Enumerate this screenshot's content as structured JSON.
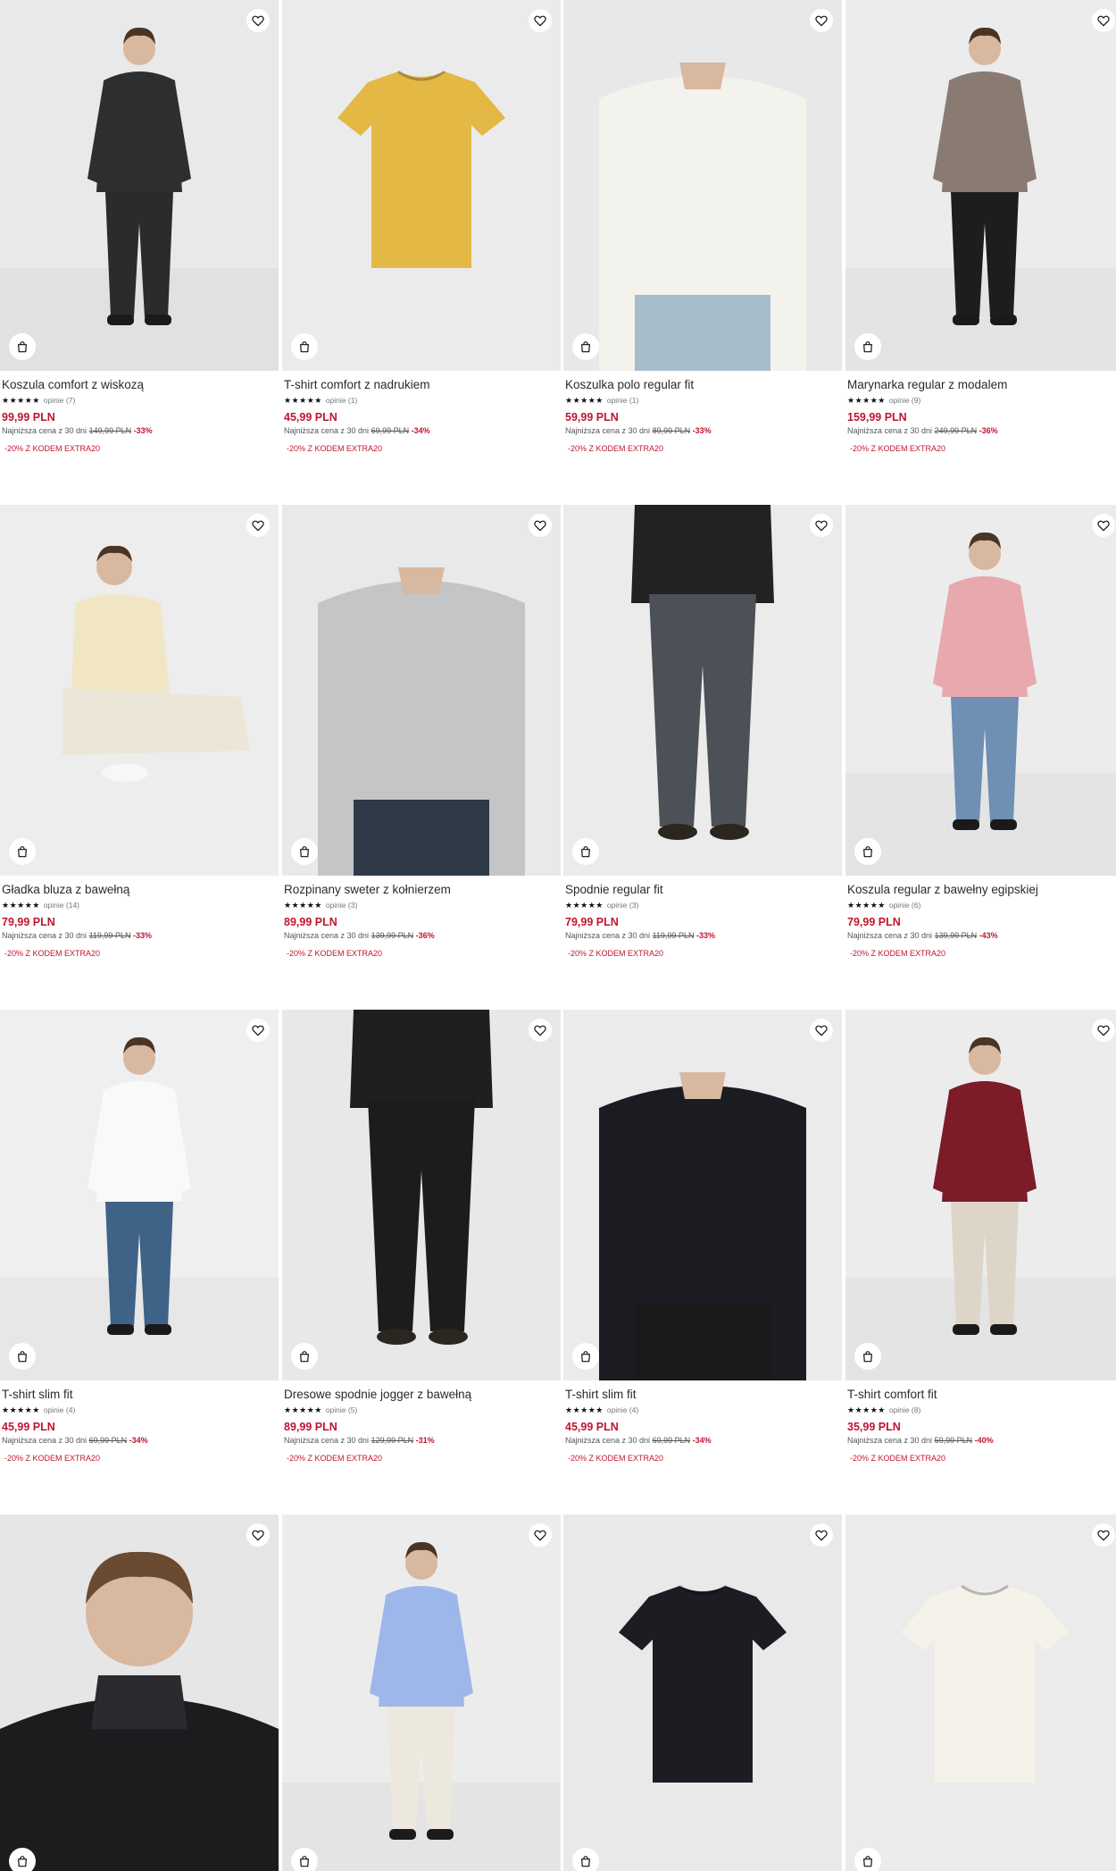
{
  "colors": {
    "price": "#c0152f",
    "promo": "#c0152f",
    "photo_bg": "#eeeeee"
  },
  "icons": {
    "favorite": "heart-icon",
    "add_to_bag": "shopping-bag-icon",
    "rating": "star-icon"
  },
  "products": [
    {
      "name": "Koszula comfort z wiskozą",
      "stars": "★★★★★",
      "reviews": "opinie (7)",
      "price": "99,99 PLN",
      "lowest_label": "Najniższa cena z 30 dni",
      "old_price": "149,99 PLN",
      "discount": "-33%",
      "promo": "-20% Z KODEM EXTRA20"
    },
    {
      "name": "T-shirt comfort z nadrukiem",
      "stars": "★★★★★",
      "reviews": "opinie (1)",
      "price": "45,99 PLN",
      "lowest_label": "Najniższa cena z 30 dni",
      "old_price": "69,99 PLN",
      "discount": "-34%",
      "promo": "-20% Z KODEM EXTRA20"
    },
    {
      "name": "Koszulka polo regular fit",
      "stars": "★★★★★",
      "reviews": "opinie (1)",
      "price": "59,99 PLN",
      "lowest_label": "Najniższa cena z 30 dni",
      "old_price": "89,99 PLN",
      "discount": "-33%",
      "promo": "-20% Z KODEM EXTRA20"
    },
    {
      "name": "Marynarka regular z modalem",
      "stars": "★★★★★",
      "reviews": "opinie (9)",
      "price": "159,99 PLN",
      "lowest_label": "Najniższa cena z 30 dni",
      "old_price": "249,99 PLN",
      "discount": "-36%",
      "promo": "-20% Z KODEM EXTRA20"
    },
    {
      "name": "Gładka bluza z bawełną",
      "stars": "★★★★★",
      "reviews": "opinie (14)",
      "price": "79,99 PLN",
      "lowest_label": "Najniższa cena z 30 dni",
      "old_price": "119,99 PLN",
      "discount": "-33%",
      "promo": "-20% Z KODEM EXTRA20"
    },
    {
      "name": "Rozpinany sweter z kołnierzem",
      "stars": "★★★★★",
      "reviews": "opinie (3)",
      "price": "89,99 PLN",
      "lowest_label": "Najniższa cena z 30 dni",
      "old_price": "139,99 PLN",
      "discount": "-36%",
      "promo": "-20% Z KODEM EXTRA20"
    },
    {
      "name": "Spodnie regular fit",
      "stars": "★★★★★",
      "reviews": "opinie (3)",
      "price": "79,99 PLN",
      "lowest_label": "Najniższa cena z 30 dni",
      "old_price": "119,99 PLN",
      "discount": "-33%",
      "promo": "-20% Z KODEM EXTRA20"
    },
    {
      "name": "Koszula regular z bawełny egipskiej",
      "stars": "★★★★★",
      "reviews": "opinie (6)",
      "price": "79,99 PLN",
      "lowest_label": "Najniższa cena z 30 dni",
      "old_price": "139,99 PLN",
      "discount": "-43%",
      "promo": "-20% Z KODEM EXTRA20"
    },
    {
      "name": "T-shirt slim fit",
      "stars": "★★★★★",
      "reviews": "opinie (4)",
      "price": "45,99 PLN",
      "lowest_label": "Najniższa cena z 30 dni",
      "old_price": "69,99 PLN",
      "discount": "-34%",
      "promo": "-20% Z KODEM EXTRA20"
    },
    {
      "name": "Dresowe spodnie jogger z bawełną",
      "stars": "★★★★★",
      "reviews": "opinie (5)",
      "price": "89,99 PLN",
      "lowest_label": "Najniższa cena z 30 dni",
      "old_price": "129,99 PLN",
      "discount": "-31%",
      "promo": "-20% Z KODEM EXTRA20"
    },
    {
      "name": "T-shirt slim fit",
      "stars": "★★★★★",
      "reviews": "opinie (4)",
      "price": "45,99 PLN",
      "lowest_label": "Najniższa cena z 30 dni",
      "old_price": "69,99 PLN",
      "discount": "-34%",
      "promo": "-20% Z KODEM EXTRA20"
    },
    {
      "name": "T-shirt comfort fit",
      "stars": "★★★★★",
      "reviews": "opinie (8)",
      "price": "35,99 PLN",
      "lowest_label": "Najniższa cena z 30 dni",
      "old_price": "59,99 PLN",
      "discount": "-40%",
      "promo": "-20% Z KODEM EXTRA20"
    },
    {
      "name": "",
      "stars": "",
      "reviews": "",
      "price": "",
      "lowest_label": "",
      "old_price": "",
      "discount": "",
      "promo": ""
    },
    {
      "name": "",
      "stars": "",
      "reviews": "",
      "price": "",
      "lowest_label": "",
      "old_price": "",
      "discount": "",
      "promo": ""
    },
    {
      "name": "",
      "stars": "",
      "reviews": "",
      "price": "",
      "lowest_label": "",
      "old_price": "",
      "discount": "",
      "promo": ""
    },
    {
      "name": "",
      "stars": "",
      "reviews": "",
      "price": "",
      "lowest_label": "",
      "old_price": "",
      "discount": "",
      "promo": ""
    }
  ]
}
